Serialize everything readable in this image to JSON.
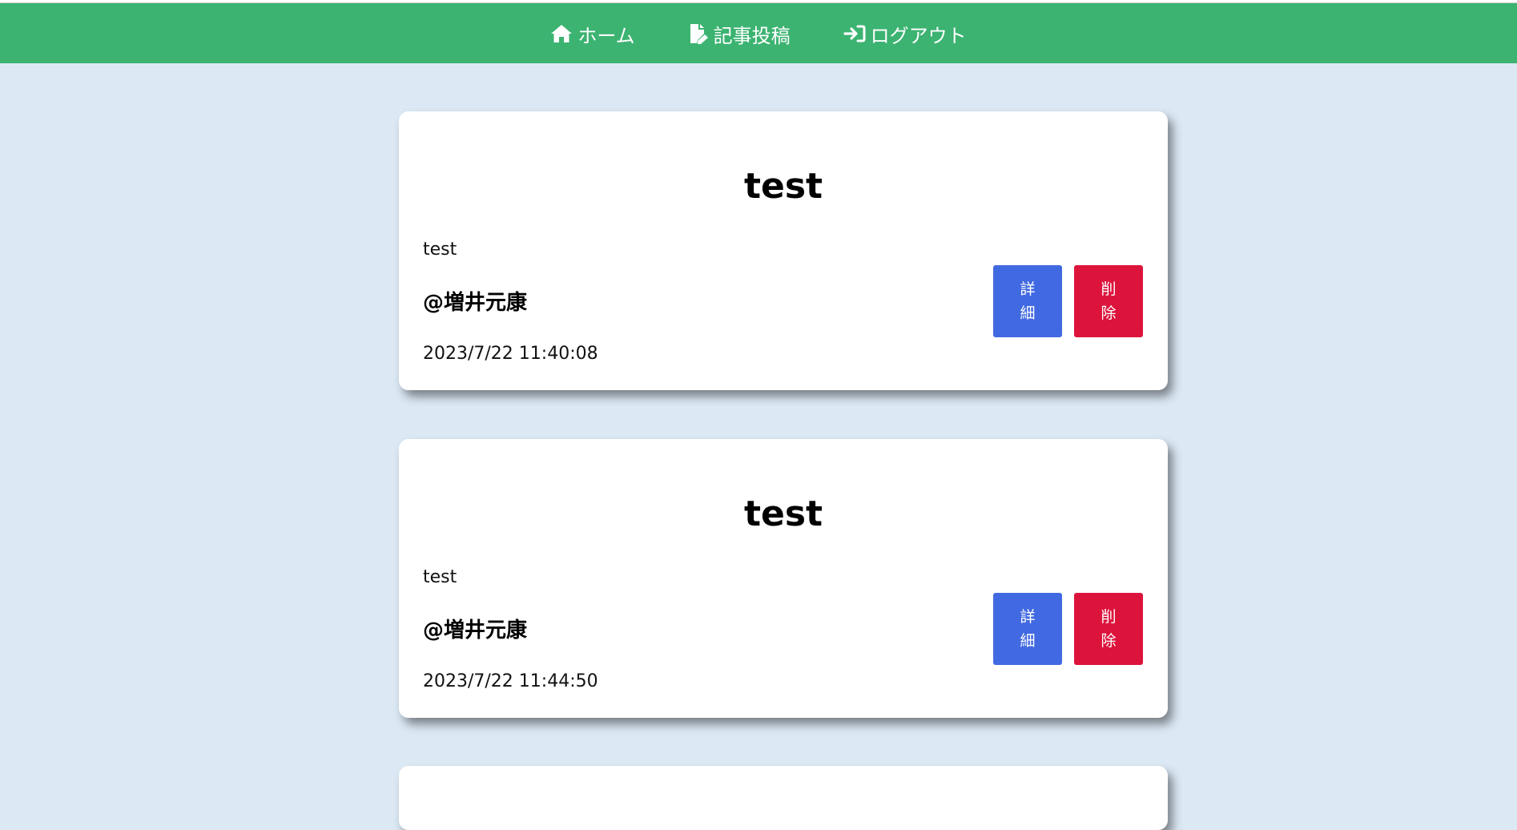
{
  "nav": {
    "items": [
      {
        "label": "ホーム",
        "icon": "home-icon"
      },
      {
        "label": "記事投稿",
        "icon": "file-edit-icon"
      },
      {
        "label": "ログアウト",
        "icon": "sign-out-icon"
      }
    ],
    "bg_color": "#3cb371"
  },
  "posts": [
    {
      "title": "test",
      "body": "test",
      "author": "@増井元康",
      "date": "2023/7/22 11:40:08",
      "detail_label": [
        "詳",
        "細"
      ],
      "delete_label": [
        "削",
        "除"
      ]
    },
    {
      "title": "test",
      "body": "test",
      "author": "@増井元康",
      "date": "2023/7/22 11:44:50",
      "detail_label": [
        "詳",
        "細"
      ],
      "delete_label": [
        "削",
        "除"
      ]
    }
  ],
  "colors": {
    "background": "#dce9f5",
    "detail_button": "#4169e1",
    "delete_button": "#dc143c"
  }
}
